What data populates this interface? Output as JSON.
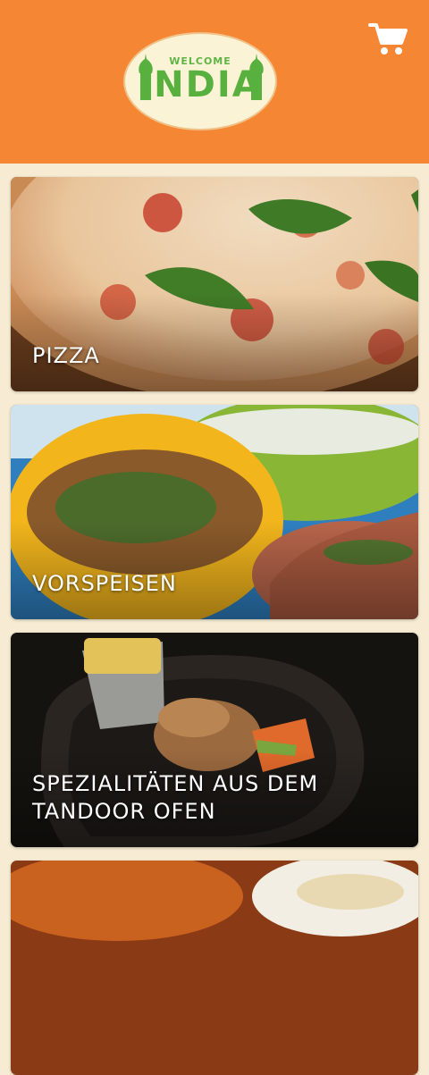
{
  "header": {
    "logo": {
      "welcome": "WELCOME",
      "name": "INDIA"
    },
    "cart_icon": "shopping-cart-icon",
    "background_color": "#f58634"
  },
  "categories": [
    {
      "label": "PIZZA",
      "image": "pizza"
    },
    {
      "label": "VORSPEISEN",
      "image": "soup-starters"
    },
    {
      "label": "SPEZIALITÄTEN AUS DEM TANDOOR OFEN",
      "image": "tandoor-sizzler"
    },
    {
      "label": "",
      "image": "curry-rice"
    }
  ],
  "colors": {
    "page_background": "#f7ecd3",
    "logo_green": "#58b03f"
  }
}
